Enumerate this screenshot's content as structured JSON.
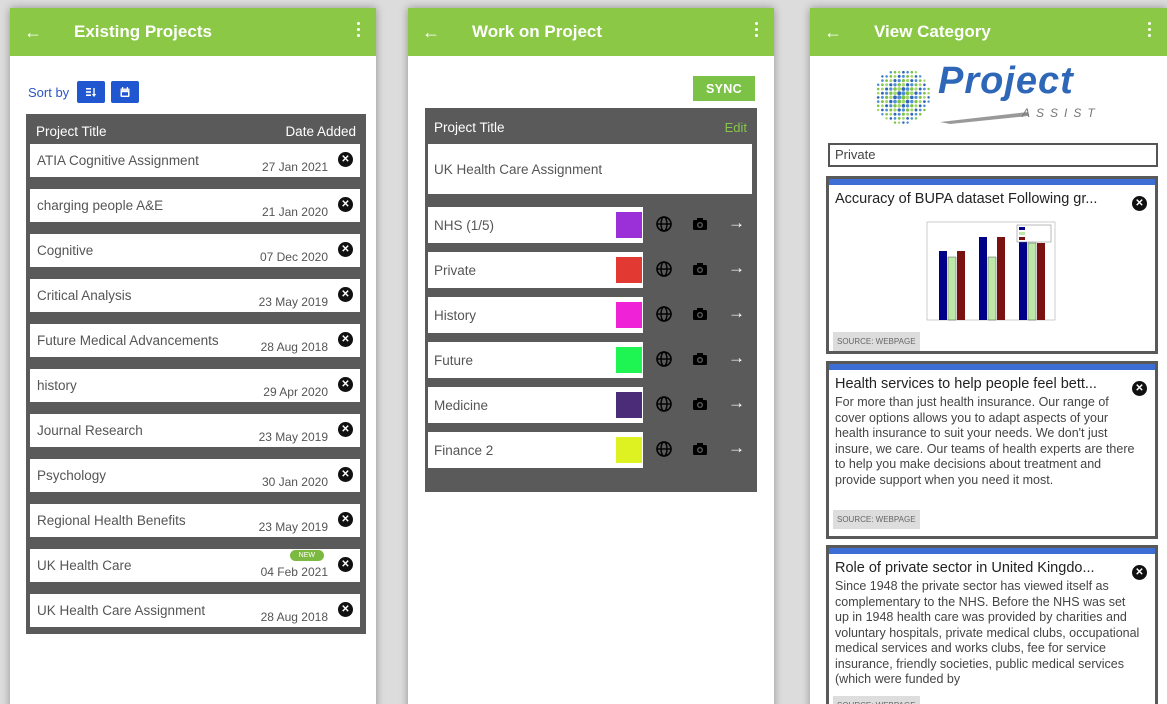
{
  "screen1": {
    "title": "Existing Projects",
    "sort_label": "Sort by",
    "sort_alpha_icon": "sort-alpha-icon",
    "sort_date_icon": "calendar-icon",
    "table": {
      "col_title": "Project Title",
      "col_date": "Date Added",
      "rows": [
        {
          "name": "ATIA Cognitive Assignment",
          "date": "27 Jan 2021"
        },
        {
          "name": "charging people A&E",
          "date": "21 Jan 2020"
        },
        {
          "name": "Cognitive",
          "date": "07 Dec 2020"
        },
        {
          "name": "Critical Analysis",
          "date": "23 May 2019"
        },
        {
          "name": "Future Medical Advancements",
          "date": "28 Aug 2018"
        },
        {
          "name": "history",
          "date": "29 Apr 2020"
        },
        {
          "name": "Journal Research",
          "date": "23 May 2019"
        },
        {
          "name": "Psychology",
          "date": "30 Jan 2020"
        },
        {
          "name": "Regional Health Benefits",
          "date": "23 May 2019"
        },
        {
          "name": "UK Health Care",
          "date": "04 Feb 2021",
          "badge": "NEW"
        },
        {
          "name": "UK Health Care Assignment",
          "date": "28 Aug 2018"
        }
      ]
    }
  },
  "screen2": {
    "title": "Work on Project",
    "sync_label": "SYNC",
    "header_label": "Project Title",
    "edit_label": "Edit",
    "project_title": "UK Health Care Assignment",
    "categories": [
      {
        "name": "NHS (1/5)",
        "color": "#9b30d9"
      },
      {
        "name": "Private",
        "color": "#e23a32"
      },
      {
        "name": "History",
        "color": "#ef22d8"
      },
      {
        "name": "Future",
        "color": "#1ef552"
      },
      {
        "name": "Medicine",
        "color": "#4b2c78"
      },
      {
        "name": "Finance 2",
        "color": "#def222"
      }
    ]
  },
  "screen3": {
    "title": "View Category",
    "logo_text": "Project",
    "logo_sub": "ASSIST",
    "category_value": "Private",
    "cards": [
      {
        "title": "Accuracy of BUPA dataset Following gr...",
        "source": "SOURCE: WEBPAGE"
      },
      {
        "title": "Health services to help people feel bett...",
        "body": "For more than just health insurance. Our range of cover options allows you to adapt aspects of your health insurance to suit your needs. We don't just insure, we care. Our teams of health experts are there to help you make decisions about treatment and provide support when you need it most.",
        "source": "SOURCE: WEBPAGE"
      },
      {
        "title": "Role of private sector in United Kingdo...",
        "body": "Since 1948 the private sector has viewed itself as complementary to the NHS. Before the NHS was set up in 1948 health care was provided by charities and voluntary hospitals, private medical clubs, occupational medical services and works clubs, fee for service insurance, friendly societies, public medical services (which were funded by",
        "source": "SOURCE: WEBPAGE"
      }
    ]
  },
  "colors": {
    "appbar": "#8ac846",
    "sort_button": "#2156d1",
    "panel": "#5a5a5a",
    "card_bar": "#3d6ed6"
  }
}
